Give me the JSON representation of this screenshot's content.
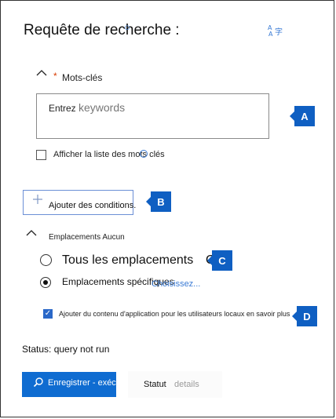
{
  "header": {
    "title": "Requête de recherche :"
  },
  "keywords": {
    "required_marker": "*",
    "label": "Mots-clés",
    "input_prefix": "Entrez",
    "input_placeholder": "keywords",
    "show_list_label": "Afficher la liste des mots clés"
  },
  "conditions": {
    "add_label": "Ajouter des conditions."
  },
  "locations": {
    "section_label": "Emplacements  Aucun",
    "all_label": "Tous les emplacements",
    "all_trailing": "O",
    "specific_label": "Emplacements spécifiques",
    "choose_link": "Choisissez...",
    "all_selected": false,
    "specific_selected": true
  },
  "app_content": {
    "label": "Ajouter du contenu d'application pour les utilisateurs locaux en savoir plus",
    "checked": true
  },
  "callouts": {
    "a": "A",
    "b": "B",
    "c": "C",
    "d": "D"
  },
  "status": {
    "text": "Status: query not run"
  },
  "footer": {
    "run_label": "Enregistrer - exécuter",
    "statut_label": "Statut",
    "details_label": "details"
  },
  "icons": {
    "translate": "translate-icon",
    "search": "search-icon",
    "plus": "plus-icon",
    "chevron": "chevron-up-icon",
    "info": "info-icon"
  },
  "colors": {
    "accent": "#0f6cd1",
    "callout": "#0f5fc2",
    "required": "#d83b01",
    "link": "#3a7bd5"
  }
}
